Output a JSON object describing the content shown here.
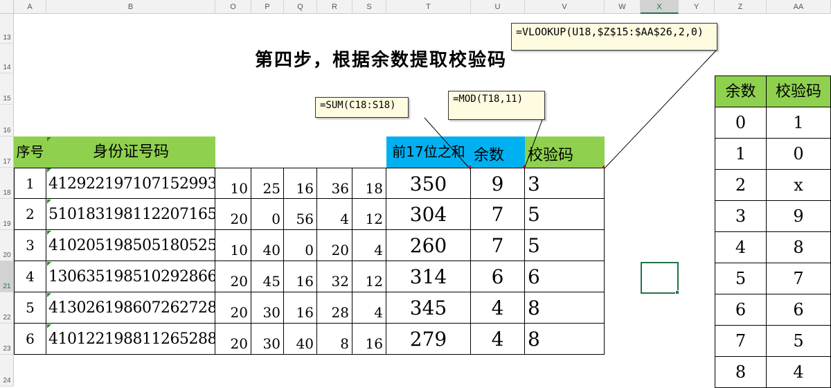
{
  "columns": [
    "A",
    "B",
    "O",
    "P",
    "Q",
    "R",
    "S",
    "T",
    "U",
    "V",
    "W",
    "X",
    "Y",
    "Z",
    "AA"
  ],
  "rows": [
    "13",
    "14",
    "15",
    "16",
    "17",
    "18",
    "19",
    "20",
    "21",
    "22",
    "23",
    "24"
  ],
  "title": "第四步，根据余数提取校验码",
  "main_table": {
    "headers": {
      "seq": "序号",
      "id": "身份证号码",
      "sum": "前17位之和",
      "rem": "余数",
      "check": "校验码"
    },
    "rows": [
      {
        "seq": "1",
        "id": "412922197107152993",
        "o": "10",
        "p": "25",
        "q": "16",
        "r": "36",
        "s": "18",
        "sum": "350",
        "rem": "9",
        "check": "3"
      },
      {
        "seq": "2",
        "id": "510183198112207165",
        "o": "20",
        "p": "0",
        "q": "56",
        "r": "4",
        "s": "12",
        "sum": "304",
        "rem": "7",
        "check": "5"
      },
      {
        "seq": "3",
        "id": "410205198505180525",
        "o": "10",
        "p": "40",
        "q": "0",
        "r": "20",
        "s": "4",
        "sum": "260",
        "rem": "7",
        "check": "5"
      },
      {
        "seq": "4",
        "id": "130635198510292866",
        "o": "20",
        "p": "45",
        "q": "16",
        "r": "32",
        "s": "12",
        "sum": "314",
        "rem": "6",
        "check": "6"
      },
      {
        "seq": "5",
        "id": "413026198607262728",
        "o": "20",
        "p": "30",
        "q": "16",
        "r": "28",
        "s": "4",
        "sum": "345",
        "rem": "4",
        "check": "8"
      },
      {
        "seq": "6",
        "id": "410122198811265288",
        "o": "20",
        "p": "30",
        "q": "40",
        "r": "8",
        "s": "16",
        "sum": "279",
        "rem": "4",
        "check": "8"
      }
    ]
  },
  "lookup_table": {
    "headers": {
      "rem": "余数",
      "check": "校验码"
    },
    "rows": [
      {
        "rem": "0",
        "check": "1"
      },
      {
        "rem": "1",
        "check": "0"
      },
      {
        "rem": "2",
        "check": "x"
      },
      {
        "rem": "3",
        "check": "9"
      },
      {
        "rem": "4",
        "check": "8"
      },
      {
        "rem": "5",
        "check": "7"
      },
      {
        "rem": "6",
        "check": "6"
      },
      {
        "rem": "7",
        "check": "5"
      },
      {
        "rem": "8",
        "check": "4"
      }
    ]
  },
  "callouts": {
    "sum": "=SUM(C18:S18)",
    "mod": "=MOD(T18,11)",
    "vlookup": "=VLOOKUP(U18,$Z$15:$AA$26,2,0)"
  },
  "colors": {
    "green": "#8fd14f",
    "blue": "#00b0f0",
    "selection": "#217346"
  }
}
